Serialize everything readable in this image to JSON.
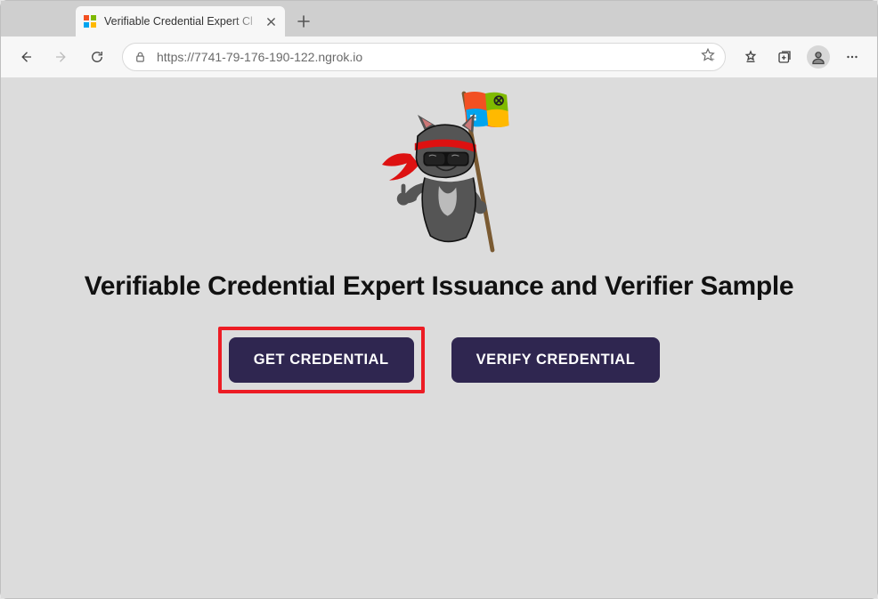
{
  "browser": {
    "tab_title": "Verifiable Credential Expert Cl",
    "url": "https://7741-79-176-190-122.ngrok.io"
  },
  "page": {
    "title": "Verifiable Credential Expert Issuance and Verifier Sample",
    "buttons": {
      "get": "GET CREDENTIAL",
      "verify": "VERIFY CREDENTIAL"
    }
  },
  "highlight_target": "get"
}
